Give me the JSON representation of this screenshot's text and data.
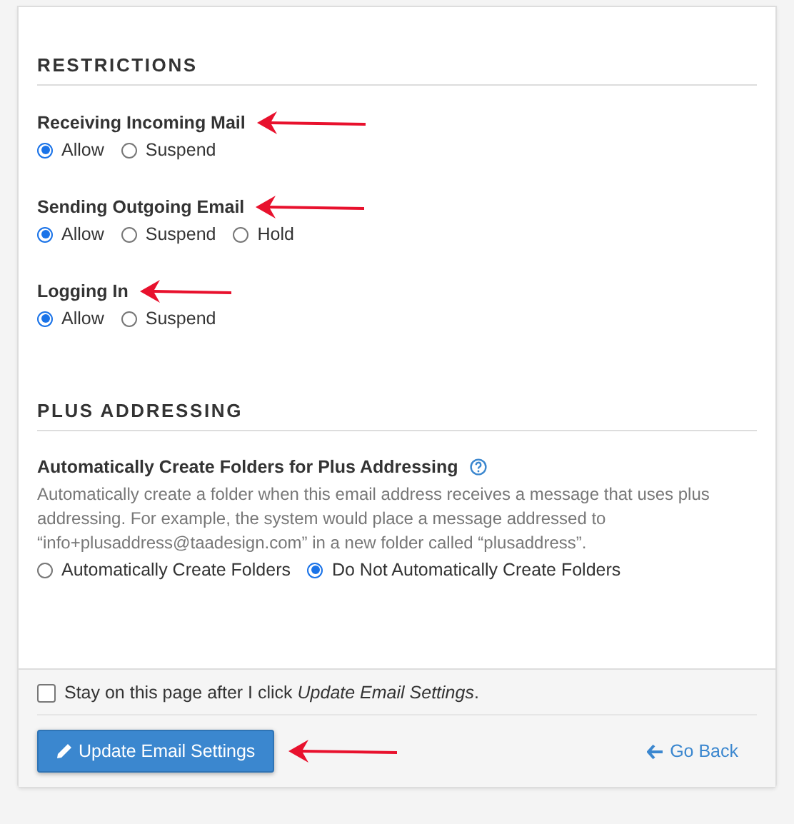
{
  "sections": [
    {
      "title": "RESTRICTIONS",
      "groups": [
        {
          "label": "Receiving Incoming Mail",
          "marked": true,
          "help": false,
          "options": [
            {
              "label": "Allow",
              "selected": true
            },
            {
              "label": "Suspend",
              "selected": false
            }
          ]
        },
        {
          "label": "Sending Outgoing Email",
          "marked": true,
          "help": false,
          "options": [
            {
              "label": "Allow",
              "selected": true
            },
            {
              "label": "Suspend",
              "selected": false
            },
            {
              "label": "Hold",
              "selected": false
            }
          ]
        },
        {
          "label": "Logging In",
          "marked": true,
          "help": false,
          "options": [
            {
              "label": "Allow",
              "selected": true
            },
            {
              "label": "Suspend",
              "selected": false
            }
          ]
        }
      ]
    },
    {
      "title": "PLUS ADDRESSING",
      "groups": [
        {
          "label": "Automatically Create Folders for Plus Addressing",
          "marked": false,
          "help": true,
          "description": "Automatically create a folder when this email address receives a message that uses plus addressing. For example, the system would place a message addressed to “info+plusaddress@taadesign.com” in a new folder called “plusaddress”.",
          "options": [
            {
              "label": "Automatically Create Folders",
              "selected": false
            },
            {
              "label": "Do Not Automatically Create Folders",
              "selected": true
            }
          ]
        }
      ]
    }
  ],
  "footer": {
    "stay": {
      "label": "Stay on this page after I click *Update Email Settings*.",
      "checked": false
    },
    "submit": {
      "label": "Update Email Settings",
      "marked": true
    },
    "back": {
      "label": "Go Back"
    }
  }
}
